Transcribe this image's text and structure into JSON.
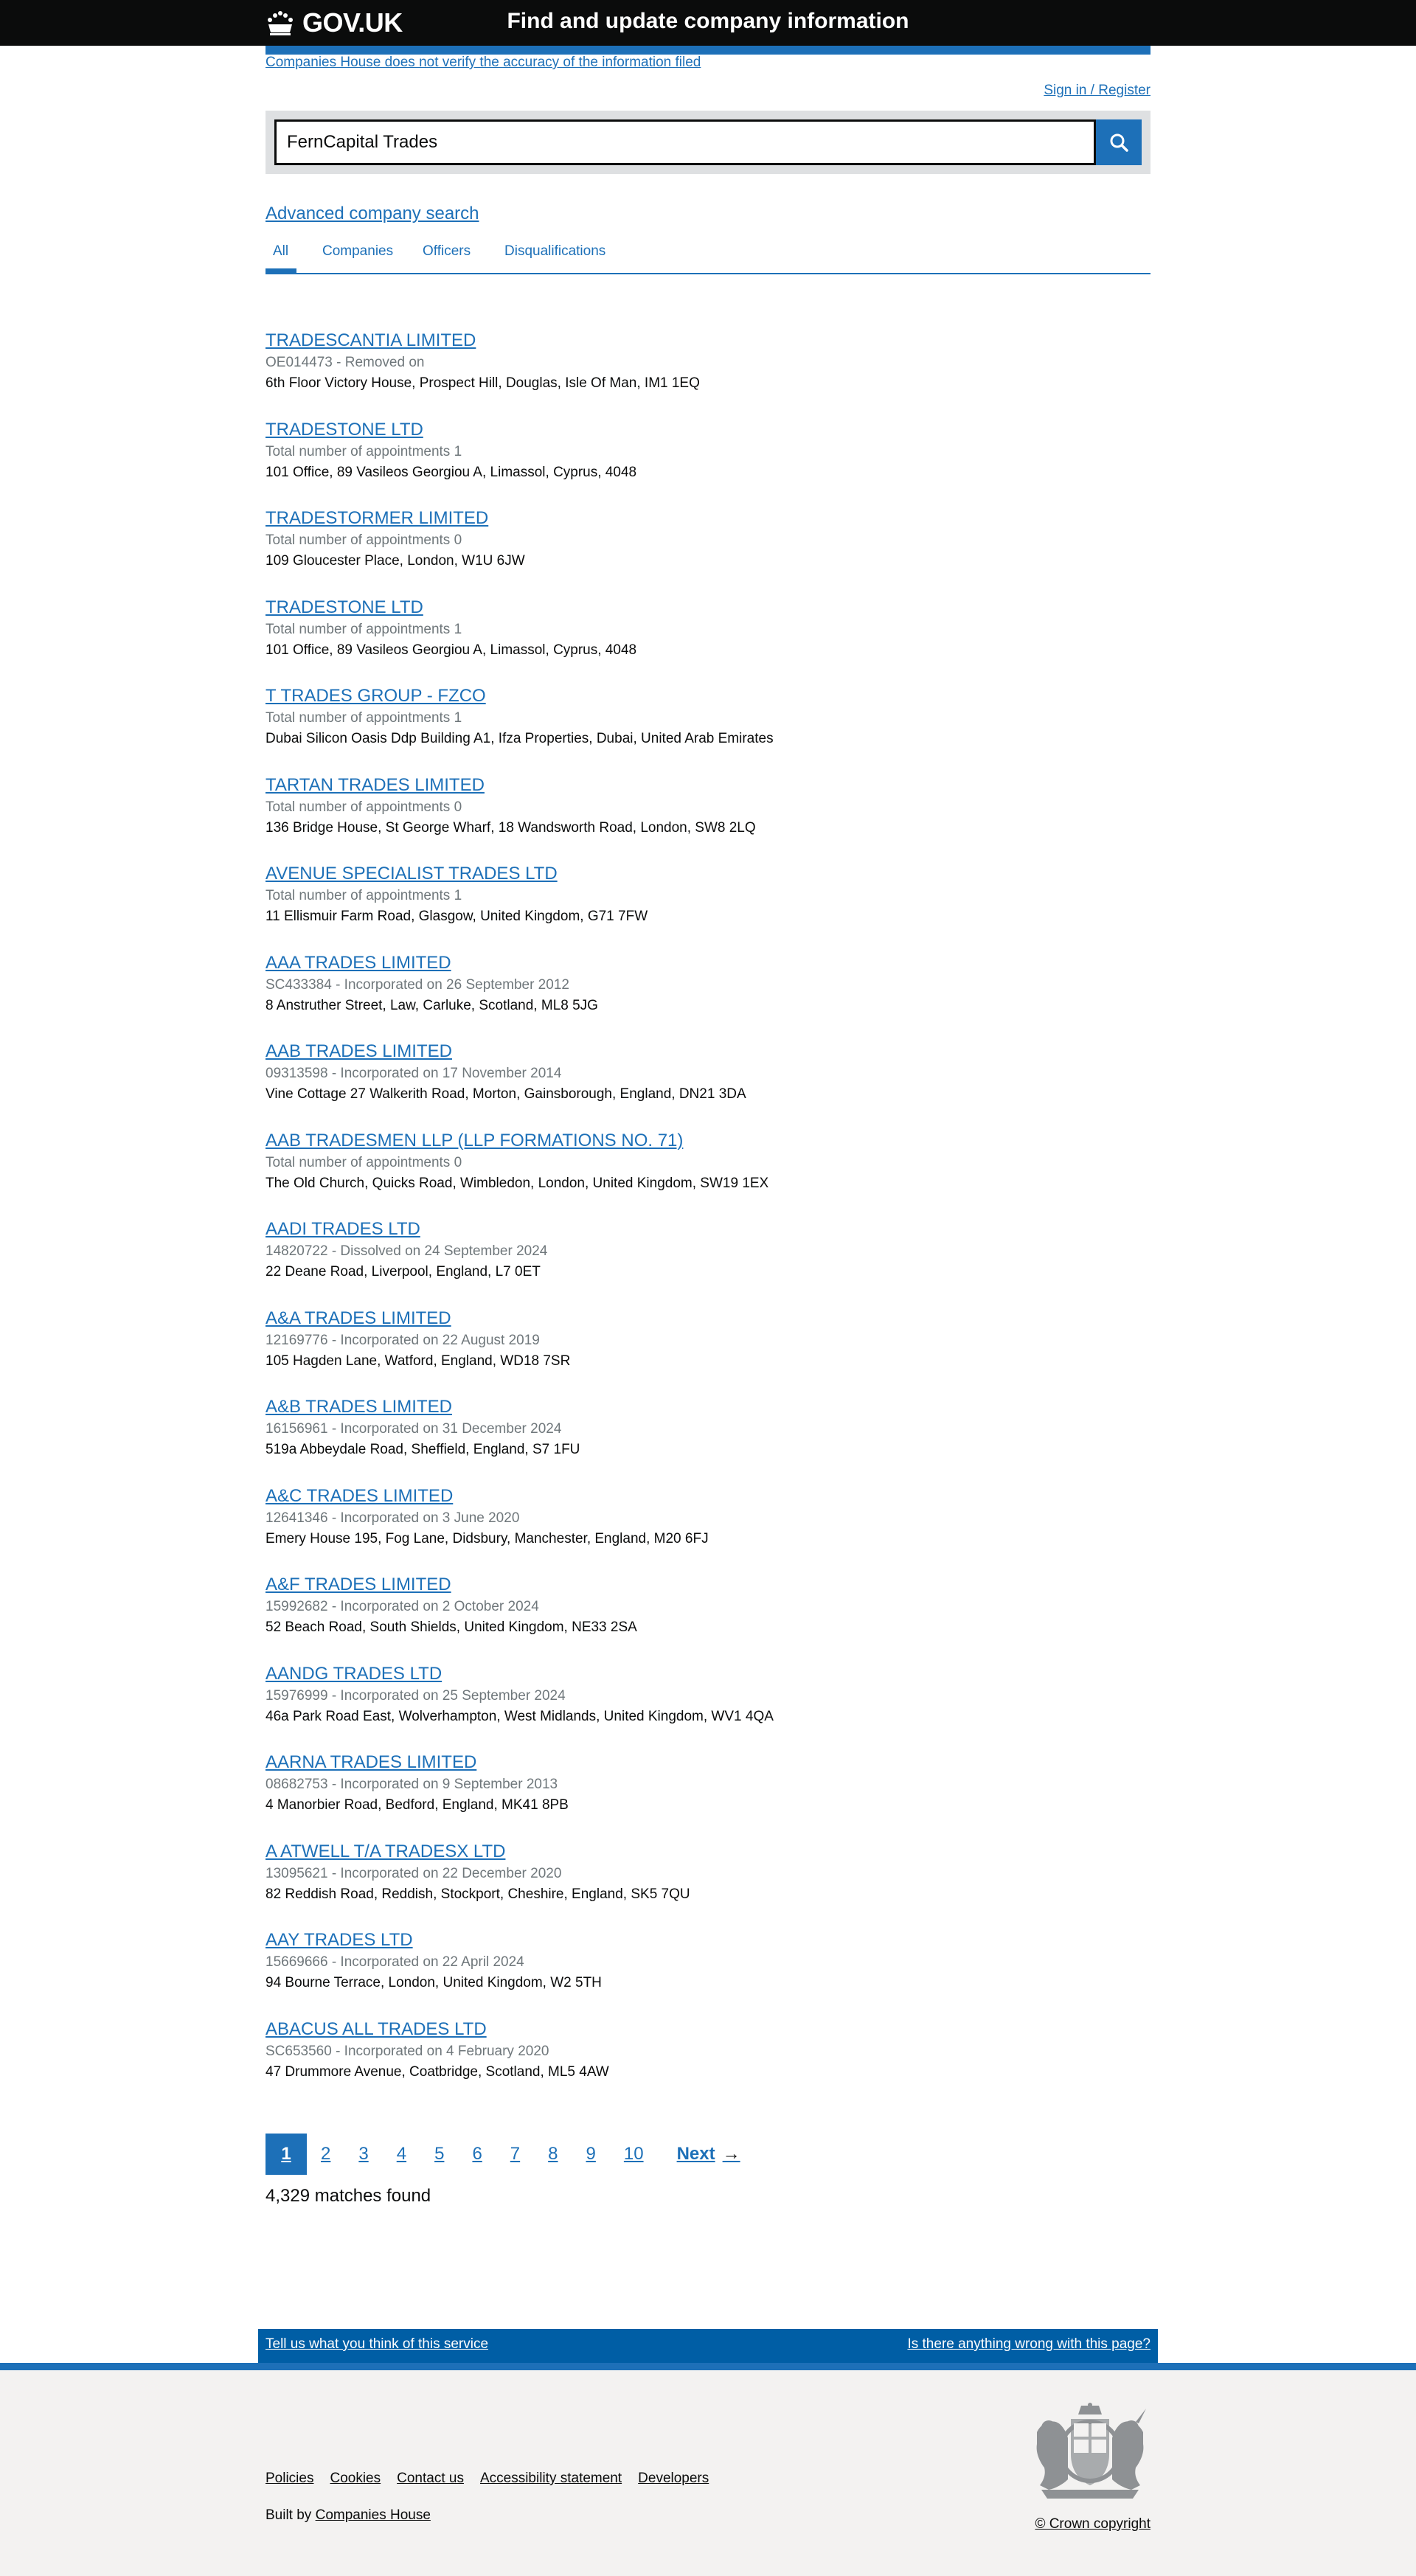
{
  "header": {
    "logo_text": "GOV.UK",
    "service_name": "Find and update company information"
  },
  "disclaimer": "Companies House does not verify the accuracy of the information filed",
  "sign_in": "Sign in / Register",
  "search": {
    "value": "FernCapital Trades"
  },
  "advanced_search": "Advanced company search",
  "tabs": [
    {
      "label": "All",
      "active": true
    },
    {
      "label": "Companies",
      "active": false
    },
    {
      "label": "Officers",
      "active": false
    },
    {
      "label": "Disqualifications",
      "active": false
    }
  ],
  "results": [
    {
      "title": "TRADESCANTIA LIMITED",
      "meta": "OE014473 - Removed on",
      "address": "6th Floor Victory House, Prospect Hill, Douglas, Isle Of Man, IM1 1EQ"
    },
    {
      "title": "TRADESTONE LTD",
      "meta": "Total number of appointments 1",
      "address": "101 Office, 89 Vasileos Georgiou A, Limassol, Cyprus, 4048"
    },
    {
      "title": "TRADESTORMER LIMITED",
      "meta": "Total number of appointments 0",
      "address": "109 Gloucester Place, London, W1U 6JW"
    },
    {
      "title": "TRADESTONE LTD",
      "meta": "Total number of appointments 1",
      "address": "101 Office, 89 Vasileos Georgiou A, Limassol, Cyprus, 4048"
    },
    {
      "title": "T TRADES GROUP - FZCO",
      "meta": "Total number of appointments 1",
      "address": "Dubai Silicon Oasis Ddp Building A1, Ifza Properties, Dubai, United Arab Emirates"
    },
    {
      "title": "TARTAN TRADES LIMITED",
      "meta": "Total number of appointments 0",
      "address": "136 Bridge House, St George Wharf, 18 Wandsworth Road, London, SW8 2LQ"
    },
    {
      "title": "AVENUE SPECIALIST TRADES LTD",
      "meta": "Total number of appointments 1",
      "address": "11 Ellismuir Farm Road, Glasgow, United Kingdom, G71 7FW"
    },
    {
      "title": "AAA TRADES LIMITED",
      "meta": "SC433384 - Incorporated on 26 September 2012",
      "address": "8 Anstruther Street, Law, Carluke, Scotland, ML8 5JG"
    },
    {
      "title": "AAB TRADES LIMITED",
      "meta": "09313598 - Incorporated on 17 November 2014",
      "address": "Vine Cottage 27 Walkerith Road, Morton, Gainsborough, England, DN21 3DA"
    },
    {
      "title": "AAB TRADESMEN LLP (LLP FORMATIONS NO. 71)",
      "meta": "Total number of appointments 0",
      "address": "The Old Church, Quicks Road, Wimbledon, London, United Kingdom, SW19 1EX"
    },
    {
      "title": "AADI TRADES LTD",
      "meta": "14820722 - Dissolved on 24 September 2024",
      "address": "22 Deane Road, Liverpool, England, L7 0ET"
    },
    {
      "title": "A&A TRADES LIMITED",
      "meta": "12169776 - Incorporated on 22 August 2019",
      "address": "105 Hagden Lane, Watford, England, WD18 7SR"
    },
    {
      "title": "A&B TRADES LIMITED",
      "meta": "16156961 - Incorporated on 31 December 2024",
      "address": "519a Abbeydale Road, Sheffield, England, S7 1FU"
    },
    {
      "title": "A&C TRADES LIMITED",
      "meta": "12641346 - Incorporated on 3 June 2020",
      "address": "Emery House 195, Fog Lane, Didsbury, Manchester, England, M20 6FJ"
    },
    {
      "title": "A&F TRADES LIMITED",
      "meta": "15992682 - Incorporated on 2 October 2024",
      "address": "52 Beach Road, South Shields, United Kingdom, NE33 2SA"
    },
    {
      "title": "AANDG TRADES LTD",
      "meta": "15976999 - Incorporated on 25 September 2024",
      "address": "46a Park Road East, Wolverhampton, West Midlands, United Kingdom, WV1 4QA"
    },
    {
      "title": "AARNA TRADES LIMITED",
      "meta": "08682753 - Incorporated on 9 September 2013",
      "address": "4 Manorbier Road, Bedford, England, MK41 8PB"
    },
    {
      "title": "A ATWELL T/A TRADESX LTD",
      "meta": "13095621 - Incorporated on 22 December 2020",
      "address": "82 Reddish Road, Reddish, Stockport, Cheshire, England, SK5 7QU"
    },
    {
      "title": "AAY TRADES LTD",
      "meta": "15669666 - Incorporated on 22 April 2024",
      "address": "94 Bourne Terrace, London, United Kingdom, W2 5TH"
    },
    {
      "title": "ABACUS ALL TRADES LTD",
      "meta": "SC653560 - Incorporated on 4 February 2020",
      "address": "47 Drummore Avenue, Coatbridge, Scotland, ML5 4AW"
    }
  ],
  "pagination": {
    "pages": [
      "1",
      "2",
      "3",
      "4",
      "5",
      "6",
      "7",
      "8",
      "9",
      "10"
    ],
    "current": "1",
    "next_label": "Next",
    "next_arrow": "→"
  },
  "matches": "4,329 matches found",
  "feedback": {
    "left": "Tell us what you think of this service",
    "right": "Is there anything wrong with this page?"
  },
  "footer": {
    "links": [
      "Policies",
      "Cookies",
      "Contact us",
      "Accessibility statement",
      "Developers"
    ],
    "built_by_prefix": "Built by ",
    "built_by_link": "Companies House",
    "copyright": "© Crown copyright"
  },
  "colors": {
    "link": "#1d70b8",
    "header_bg": "#0b0c0c",
    "footer_bg": "#f3f2f1",
    "feedback_bg": "#005ea5",
    "meta_text": "#6f777b"
  }
}
